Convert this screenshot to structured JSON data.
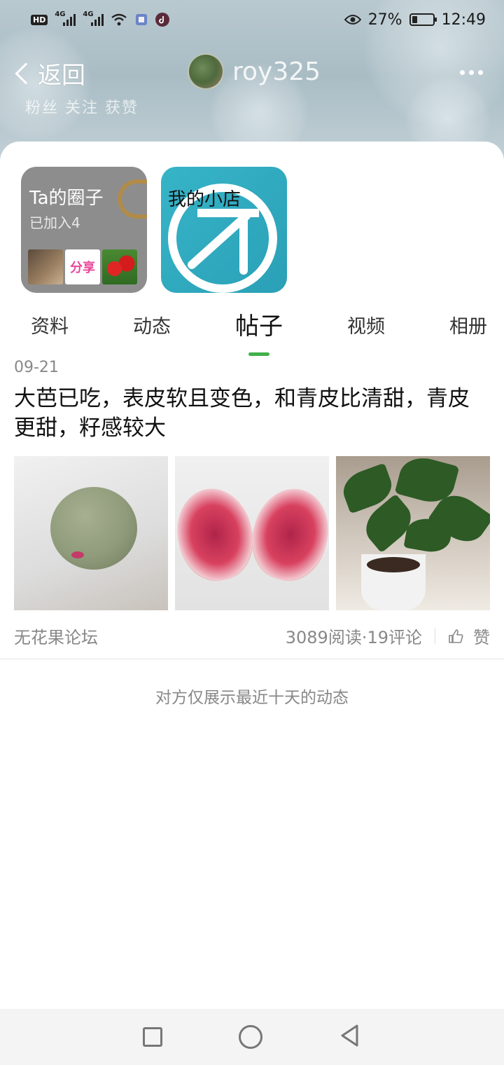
{
  "status_bar": {
    "hd": "HD",
    "net1": "4G",
    "net2": "4G",
    "battery_pct": "27%",
    "time": "12:49",
    "battery_level": 0.27
  },
  "nav": {
    "back_label": "返回",
    "username": "roy325",
    "faded_stats": "粉丝   关注   获赞"
  },
  "cards": {
    "circle": {
      "title": "Ta的圈子",
      "subtitle": "已加入4",
      "thumb_share": "分享"
    },
    "shop": {
      "title": "我的小店"
    }
  },
  "tabs": [
    {
      "label": "资料"
    },
    {
      "label": "动态"
    },
    {
      "label": "帖子",
      "active": true
    },
    {
      "label": "视频"
    },
    {
      "label": "相册"
    }
  ],
  "post": {
    "date": "09-21",
    "text": "大芭已吃，表皮软且变色，和青皮比清甜，青皮更甜，籽感较大",
    "forum": "无花果论坛",
    "stats": "3089阅读·19评论",
    "like_label": "赞"
  },
  "notice": "对方仅展示最近十天的动态",
  "icons": {
    "back": "chevron-left-icon",
    "more": "more-dots-icon",
    "like": "thumbs-up-icon"
  },
  "colors": {
    "accent": "#3fb04a",
    "shop_bg": "#37b4c8"
  }
}
